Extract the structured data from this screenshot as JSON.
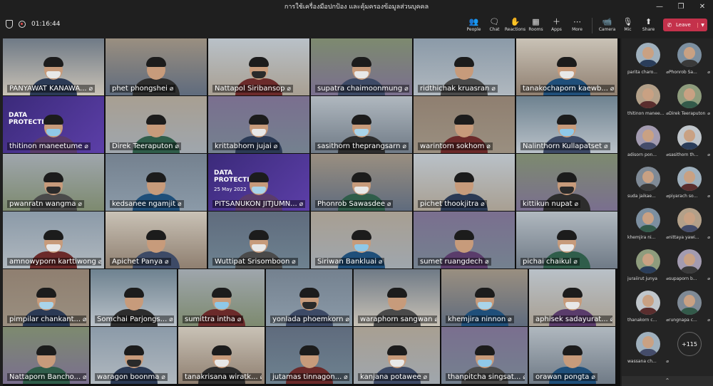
{
  "window": {
    "title": "การใช้เครื่องมือปกป้อง และคุ้มครองข้อมูลส่วนบุคคล"
  },
  "meeting": {
    "timer": "01:16:44"
  },
  "toolbar": {
    "people": "People",
    "chat": "Chat",
    "reactions": "Reactions",
    "rooms": "Rooms",
    "apps": "Apps",
    "more": "More",
    "camera": "Camera",
    "mic": "Mic",
    "share": "Share",
    "leave": "Leave"
  },
  "tiles": [
    [
      "PANYAWAT KANAWA...",
      "phet phongshei",
      "Nattapol Siribansop",
      "supatra chaimoonmung",
      "ridthichak kruasran",
      "tanakochaporn kaewb..."
    ],
    [
      "thitinon maneetume",
      "Direk Teeraputon",
      "krittabhorn jujai",
      "sasithorn theprangsarn",
      "warintorn sokhom",
      "Nalinthorn Kullapatset"
    ],
    [
      "pwanratn wangma",
      "kedsanee ngamjit",
      "PITSANUKON JITJUMN...",
      "Phonrob Sawasdee",
      "pichet thookjitra",
      "kittikun nupat"
    ],
    [
      "amnowyporn karttiwong",
      "Apichet Panya",
      "Wuttipat Srisomboon",
      "Siriwan Bankluai",
      "sumet ruangdech",
      "pichai chaikul"
    ],
    [
      "pimpilar chankant...",
      "Somchai Parjongs...",
      "sumittra intha",
      "yonlada phoemkorn",
      "waraphorn sangwan",
      "khemjira ninnon",
      "aphisek sadayurat..."
    ],
    [
      "Nattaporn Bancho...",
      "waragon boonma",
      "tanakrisana wiratk...",
      "jutamas tinnagon...",
      "kanjana potawee",
      "thanpitcha singsat...",
      "orawan pongta"
    ]
  ],
  "slide_text": {
    "title": "DATA PROTECTION",
    "date": "25 May 2022"
  },
  "participants": [
    "parita charo...",
    "Phonrob Sa...",
    "thitinon manee...",
    "Direk Teeraputon",
    "adisorn pon...",
    "sasithorn th...",
    "suda jaikae...",
    "piyarach so...",
    "khemjira ni...",
    "nittaya yawi...",
    "juraiirut junya",
    "supaporn b...",
    "thanakorn c...",
    "rungnapa c...",
    "wassana ch..."
  ],
  "more_count": "+115",
  "colors": {
    "leave": "#c4314b",
    "background": "#1f1f1f",
    "panel": "#242424"
  },
  "icons": {
    "muted": "mic-off-icon"
  }
}
